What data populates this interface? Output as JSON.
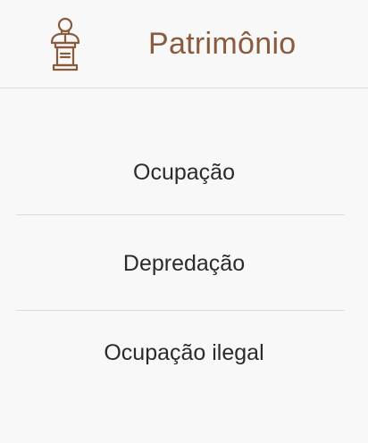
{
  "header": {
    "title": "Patrimônio",
    "icon": "bust-statue-icon",
    "title_color": "#8a5a3c"
  },
  "menu": {
    "items": [
      {
        "label": "Ocupação"
      },
      {
        "label": "Depredação"
      },
      {
        "label": "Ocupação ilegal"
      }
    ]
  }
}
